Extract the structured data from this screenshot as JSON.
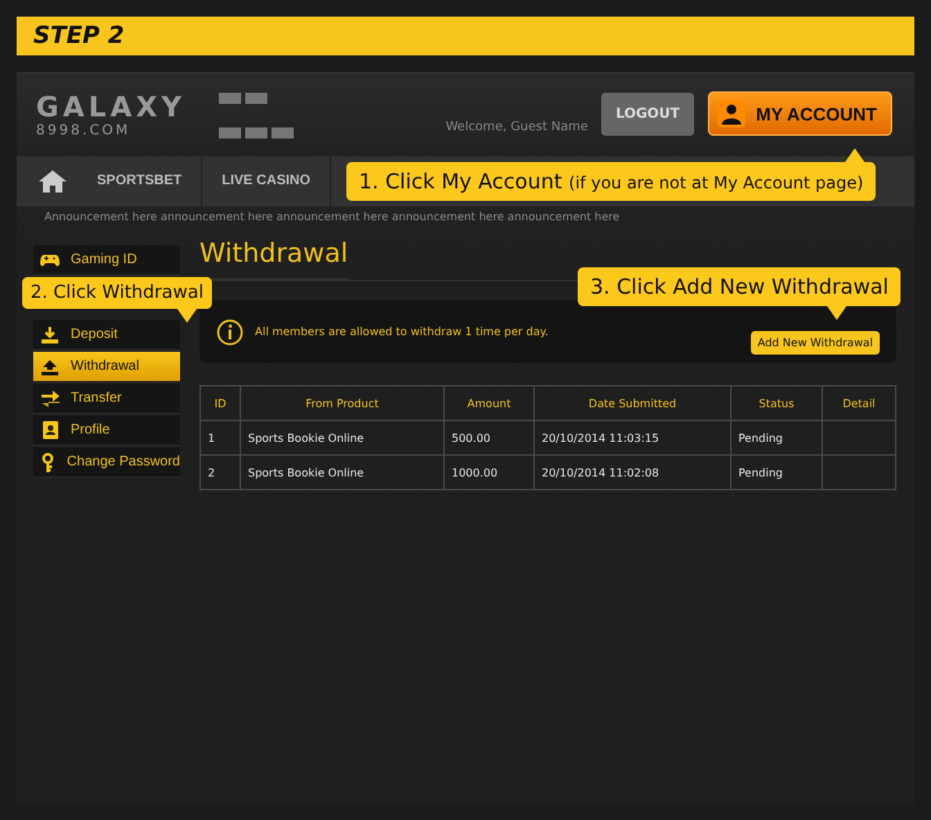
{
  "step_banner": {
    "title": "STEP 2"
  },
  "header": {
    "logo_text": "GALAXY",
    "logo_subtext": "8998.COM",
    "welcome": "Welcome, Guest Name",
    "logout": "LOGOUT",
    "account": "MY ACCOUNT"
  },
  "nav": {
    "items": [
      "SPORTSBET",
      "LIVE CASINO"
    ]
  },
  "announcement": "Announcement here announcement here announcement here announcement here announcement here",
  "sidebar": {
    "items": [
      {
        "label": "Gaming ID",
        "kind": "gamepad",
        "selected": false
      },
      {
        "label": "Deposit",
        "kind": "deposit",
        "selected": false
      },
      {
        "label": "Withdrawal",
        "kind": "withdraw",
        "selected": true
      },
      {
        "label": "Transfer",
        "kind": "transfer",
        "selected": false
      },
      {
        "label": "Profile",
        "kind": "profile",
        "selected": false
      },
      {
        "label": "Change Password",
        "kind": "key",
        "selected": false
      }
    ]
  },
  "content": {
    "title": "Withdrawal",
    "notice": "All members are allowed to withdraw 1 time per day.",
    "add_button": "Add New Withdrawal",
    "table": {
      "columns": [
        "ID",
        "From Product",
        "Amount",
        "Date Submitted",
        "Status",
        "Detail"
      ],
      "rows": [
        [
          "1",
          "Sports Bookie Online",
          "500.00",
          "20/10/2014 11:03:15",
          "Pending",
          ""
        ],
        [
          "2",
          "Sports Bookie Online",
          "1000.00",
          "20/10/2014 11:02:08",
          "Pending",
          ""
        ]
      ]
    }
  },
  "callouts": [
    {
      "kind": "account",
      "text": "1. Click My Account",
      "note": "(if you are not at My Account page)"
    },
    {
      "kind": "sidebar",
      "text": "2. Click Withdrawal"
    },
    {
      "kind": "add",
      "text": "3. Click Add New Withdrawal"
    }
  ]
}
